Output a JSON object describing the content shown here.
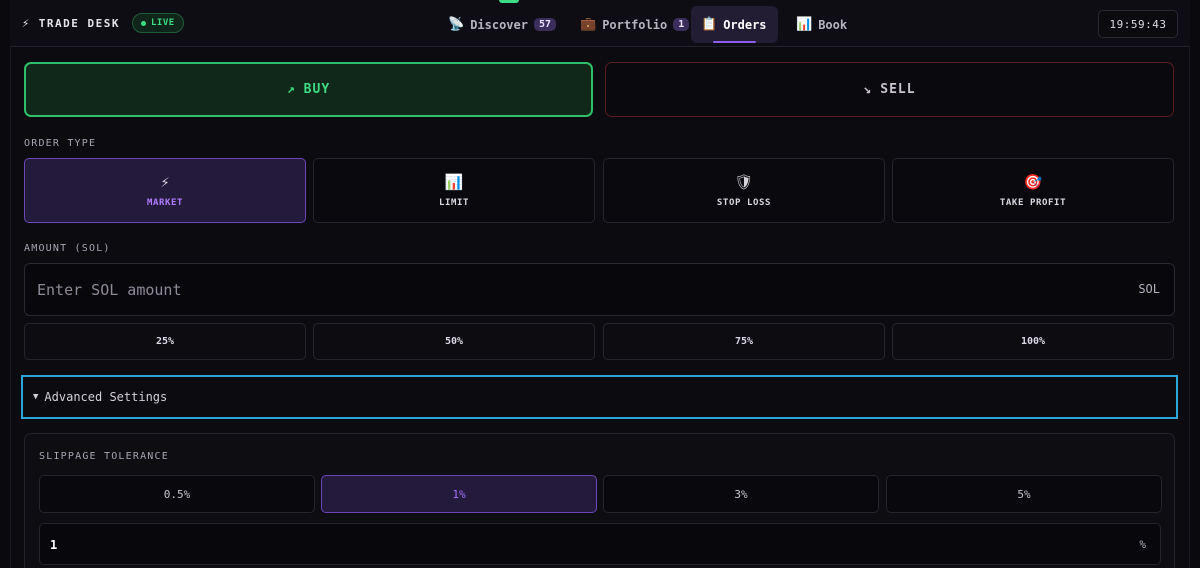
{
  "header": {
    "brand": "TRADE DESK",
    "brand_icon": "lightning-icon",
    "live_label": "LIVE",
    "clock": "19:59:43",
    "tabs": [
      {
        "label": "Discover",
        "icon": "satellite-icon",
        "badge": "57",
        "active": false
      },
      {
        "label": "Portfolio",
        "icon": "briefcase-icon",
        "badge": "1",
        "active": false
      },
      {
        "label": "Orders",
        "icon": "clipboard-icon",
        "badge": "",
        "active": true
      },
      {
        "label": "Book",
        "icon": "bar-chart-icon",
        "badge": "",
        "active": false
      }
    ]
  },
  "side": {
    "buy_label": "BUY",
    "sell_label": "SELL",
    "selected": "BUY"
  },
  "order_type": {
    "label": "ORDER TYPE",
    "options": [
      {
        "label": "MARKET",
        "icon": "lightning-icon",
        "active": true
      },
      {
        "label": "LIMIT",
        "icon": "bar-chart-icon",
        "active": false
      },
      {
        "label": "STOP LOSS",
        "icon": "shield-icon",
        "active": false
      },
      {
        "label": "TAKE PROFIT",
        "icon": "target-icon",
        "active": false
      }
    ]
  },
  "amount": {
    "label": "AMOUNT (SOL)",
    "placeholder": "Enter SOL amount",
    "value": "",
    "unit": "SOL",
    "presets": [
      "25%",
      "50%",
      "75%",
      "100%"
    ]
  },
  "advanced": {
    "label": "Advanced Settings",
    "expanded": true
  },
  "slippage": {
    "label": "SLIPPAGE TOLERANCE",
    "options": [
      "0.5%",
      "1%",
      "3%",
      "5%"
    ],
    "selected": "1%",
    "value": "1",
    "unit": "%"
  },
  "colors": {
    "accent_purple": "#8e5cf0",
    "buy_green": "#3ddc84",
    "sell_red": "#5a1e22",
    "focus_blue": "#2aa7d8"
  }
}
